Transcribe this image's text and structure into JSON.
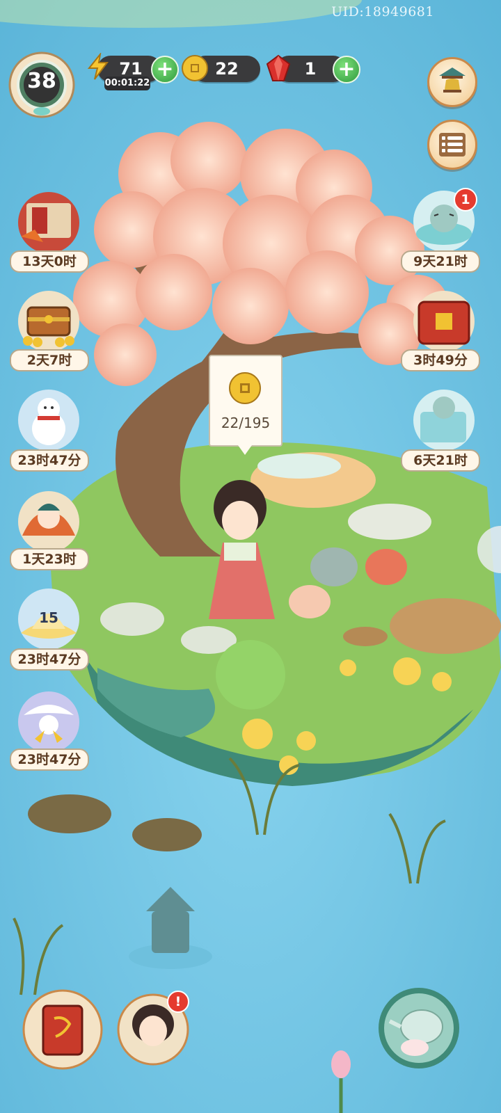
{
  "uid": "UID:18949681",
  "level": "38",
  "resources": {
    "energy": {
      "icon": "lightning-icon",
      "value": "71",
      "timer": "00:01:22"
    },
    "coins": {
      "icon": "coin-icon",
      "value": "22"
    },
    "gems": {
      "icon": "ruby-icon",
      "value": "1"
    }
  },
  "right_events": [
    {
      "name": "bath-cat-event",
      "label": "9天21时",
      "badge": "1"
    },
    {
      "name": "red-box-event",
      "label": "3时49分"
    },
    {
      "name": "gift-cat-event",
      "label": "6天21时"
    }
  ],
  "left_events": [
    {
      "name": "scroll-event",
      "label": "13天0时"
    },
    {
      "name": "treasure-chest-event",
      "label": "2天7时"
    },
    {
      "name": "snowman-event",
      "label": "23时47分"
    },
    {
      "name": "maple-character-event",
      "label": "1天23时"
    },
    {
      "name": "lotus-event",
      "label": "23时47分",
      "number": "15"
    },
    {
      "name": "crane-event",
      "label": "23时47分"
    }
  ],
  "tooltip": {
    "icon": "coin-icon",
    "text": "22/195"
  },
  "colors": {
    "water": "#7cc8e6",
    "grass": "#8fc760",
    "blossom": "#f6c3ae",
    "trunk": "#8b6446",
    "badge_red": "#e53b2f",
    "plus_green": "#2f9a3d"
  }
}
